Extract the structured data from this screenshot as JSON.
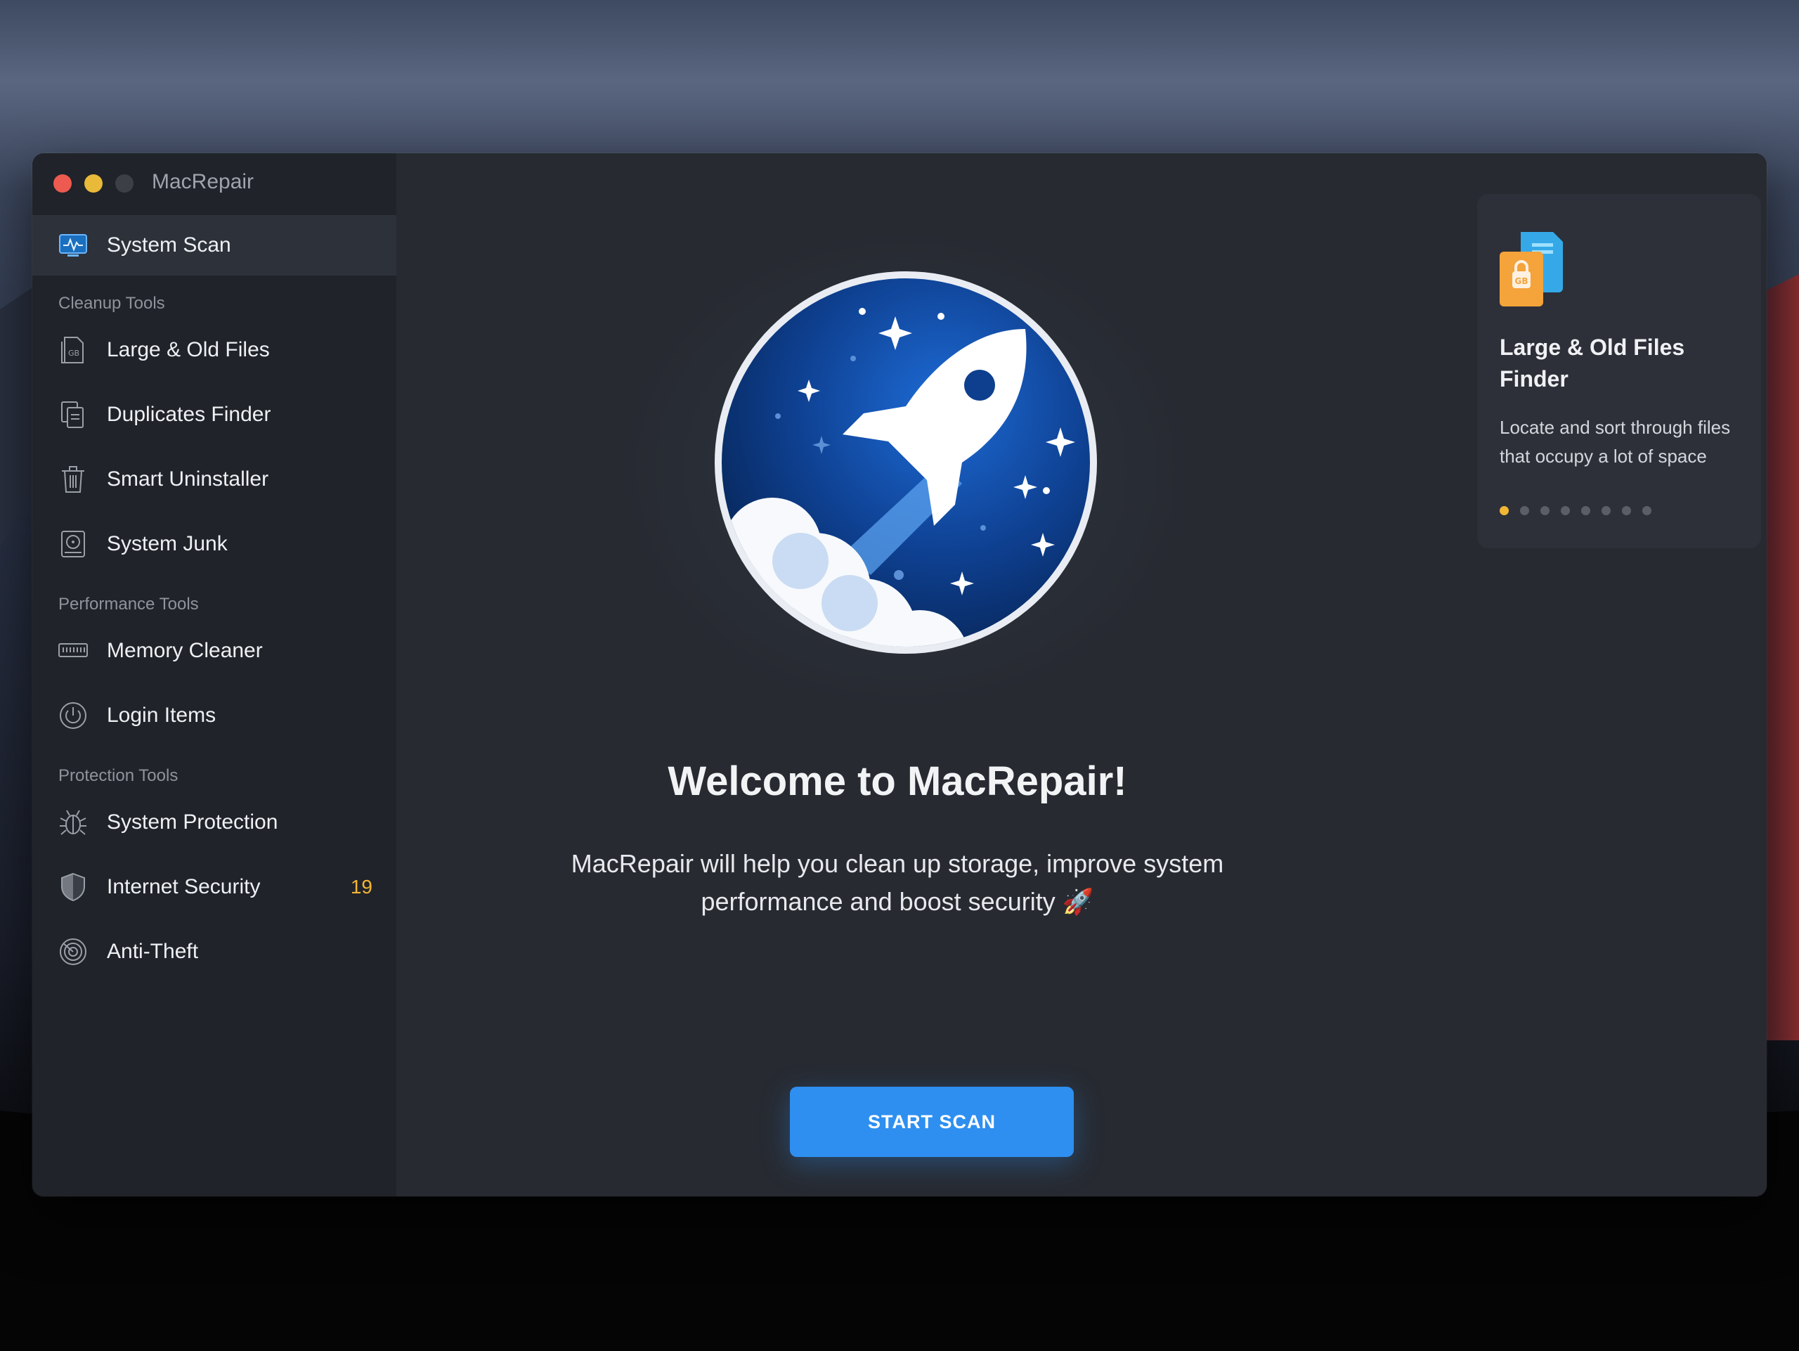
{
  "window": {
    "app_title": "MacRepair"
  },
  "sidebar": {
    "top_item": {
      "label": "System Scan",
      "icon": "monitor-pulse-icon"
    },
    "sections": [
      {
        "heading": "Cleanup Tools",
        "items": [
          {
            "label": "Large & Old Files",
            "icon": "gb-file-icon"
          },
          {
            "label": "Duplicates Finder",
            "icon": "duplicate-files-icon"
          },
          {
            "label": "Smart Uninstaller",
            "icon": "trash-icon"
          },
          {
            "label": "System Junk",
            "icon": "hard-drive-icon"
          }
        ]
      },
      {
        "heading": "Performance Tools",
        "items": [
          {
            "label": "Memory Cleaner",
            "icon": "memory-chip-icon"
          },
          {
            "label": "Login Items",
            "icon": "power-icon"
          }
        ]
      },
      {
        "heading": "Protection Tools",
        "items": [
          {
            "label": "System Protection",
            "icon": "bug-icon"
          },
          {
            "label": "Internet Security",
            "icon": "shield-icon",
            "badge": "19"
          },
          {
            "label": "Anti-Theft",
            "icon": "radar-icon"
          }
        ]
      }
    ]
  },
  "main": {
    "welcome_title": "Welcome to MacRepair!",
    "subtitle_line1": "MacRepair will help you clean up storage, improve system",
    "subtitle_line2": "performance and boost security 🚀",
    "start_button": "START SCAN",
    "hero_icon": "rocket-icon"
  },
  "card": {
    "title": "Large & Old Files Finder",
    "description": "Locate and sort through files that occupy a lot of space",
    "icon": "gb-file-icon",
    "dots_total": 8,
    "dots_active": 1
  },
  "colors": {
    "accent_blue": "#2e8ff0",
    "badge_orange": "#f2b635",
    "traffic_close": "#ed5a50",
    "traffic_min": "#e9b93a"
  }
}
